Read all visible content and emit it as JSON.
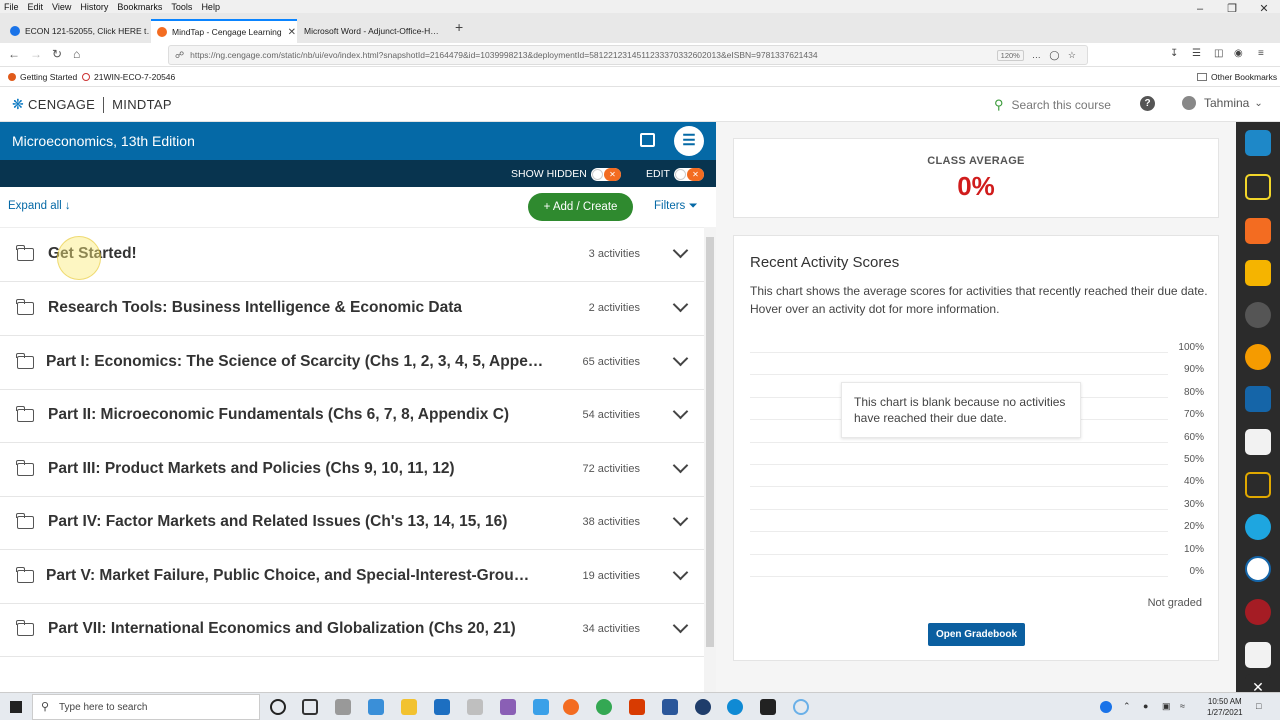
{
  "browser": {
    "menu": [
      "File",
      "Edit",
      "View",
      "History",
      "Bookmarks",
      "Tools",
      "Help"
    ],
    "tabs": [
      {
        "label": "ECON 121-52055, Click HERE t…",
        "color": "#1a73e8"
      },
      {
        "label": "MindTap - Cengage Learning",
        "color": "#f36c21"
      },
      {
        "label": "Microsoft Word - Adjunct-Office-H…",
        "color": "#666666"
      }
    ],
    "url": "https://ng.cengage.com/static/nb/ui/evo/index.html?snapshotId=2164479&id=1039998213&deploymentId=5812212314511233370332602013&eISBN=9781337621434",
    "zoom": "120%",
    "bookmarks": [
      "Getting Started",
      "21WIN-ECO-7-20546"
    ],
    "other_bookmarks": "Other Bookmarks"
  },
  "header": {
    "brand": "CENGAGE",
    "product": "MINDTAP",
    "search_placeholder": "Search this course",
    "user": "Tahmina"
  },
  "course": {
    "title": "Microeconomics, 13th Edition",
    "show_hidden": "SHOW HIDDEN",
    "edit": "EDIT",
    "expand_all": "Expand all",
    "add_create": "+ Add / Create",
    "filters": "Filters",
    "units": [
      {
        "name": "Get Started!",
        "count": "3 activities"
      },
      {
        "name": "Research Tools: Business Intelligence & Economic Data",
        "count": "2 activities"
      },
      {
        "name": "Part I: Economics: The Science of Scarcity (Chs 1, 2, 3, 4, 5, Appe…",
        "count": "65 activities"
      },
      {
        "name": "Part II: Microeconomic Fundamentals (Chs 6, 7, 8, Appendix C)",
        "count": "54 activities"
      },
      {
        "name": "Part III: Product Markets and Policies (Chs 9, 10, 11, 12)",
        "count": "72 activities"
      },
      {
        "name": "Part IV: Factor Markets and Related Issues (Ch's 13, 14, 15, 16)",
        "count": "38 activities"
      },
      {
        "name": "Part V: Market Failure, Public Choice, and Special-Interest-Grou…",
        "count": "19 activities"
      },
      {
        "name": "Part VII: International Economics and Globalization (Chs 20, 21)",
        "count": "34 activities"
      }
    ]
  },
  "scores": {
    "class_average_label": "CLASS AVERAGE",
    "class_average_value": "0%",
    "recent_title": "Recent Activity Scores",
    "recent_desc": "This chart shows the average scores for activities that recently reached their due date. Hover over an activity dot for more information.",
    "y_labels": [
      "100%",
      "90%",
      "80%",
      "70%",
      "60%",
      "50%",
      "40%",
      "30%",
      "20%",
      "10%",
      "0%"
    ],
    "blank_msg": "This chart is blank because no activities have reached their due date.",
    "not_graded": "Not graded",
    "open_gradebook": "Open Gradebook"
  },
  "taskbar": {
    "search_placeholder": "Type here to search",
    "time": "10:50 AM",
    "date": "1/27/2021"
  }
}
